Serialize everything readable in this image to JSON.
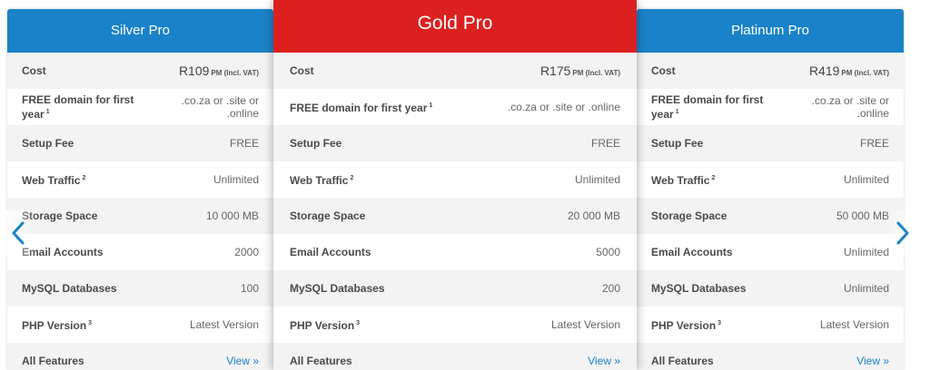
{
  "colors": {
    "silver_header": "#1a82c8",
    "gold_header": "#dc2020",
    "platinum_header": "#1a82c8",
    "link": "#1a82c8"
  },
  "labels": {
    "cost": "Cost",
    "domain": "FREE domain for first year",
    "domain_note": "1",
    "setup": "Setup Fee",
    "traffic": "Web Traffic",
    "traffic_note": "2",
    "storage": "Storage Space",
    "email": "Email Accounts",
    "mysql": "MySQL Databases",
    "php": "PHP Version",
    "php_note": "3",
    "features": "All Features"
  },
  "plans": [
    {
      "name": "Silver Pro",
      "price": "R109",
      "price_suffix": "PM (Incl. VAT)",
      "domain": ".co.za or .site or .online",
      "setup": "FREE",
      "traffic": "Unlimited",
      "storage": "10 000 MB",
      "email": "2000",
      "mysql": "100",
      "php": "Latest Version",
      "features": "View »"
    },
    {
      "name": "Gold Pro",
      "price": "R175",
      "price_suffix": "PM (Incl. VAT)",
      "domain": ".co.za or .site or .online",
      "setup": "FREE",
      "traffic": "Unlimited",
      "storage": "20 000 MB",
      "email": "5000",
      "mysql": "200",
      "php": "Latest Version",
      "features": "View »"
    },
    {
      "name": "Platinum Pro",
      "price": "R419",
      "price_suffix": "PM (Incl. VAT)",
      "domain": ".co.za or .site or .online",
      "setup": "FREE",
      "traffic": "Unlimited",
      "storage": "50 000 MB",
      "email": "Unlimited",
      "mysql": "Unlimited",
      "php": "Latest Version",
      "features": "View »"
    }
  ],
  "carousel": {
    "prev_icon": "chevron-left-icon",
    "next_icon": "chevron-right-icon"
  }
}
